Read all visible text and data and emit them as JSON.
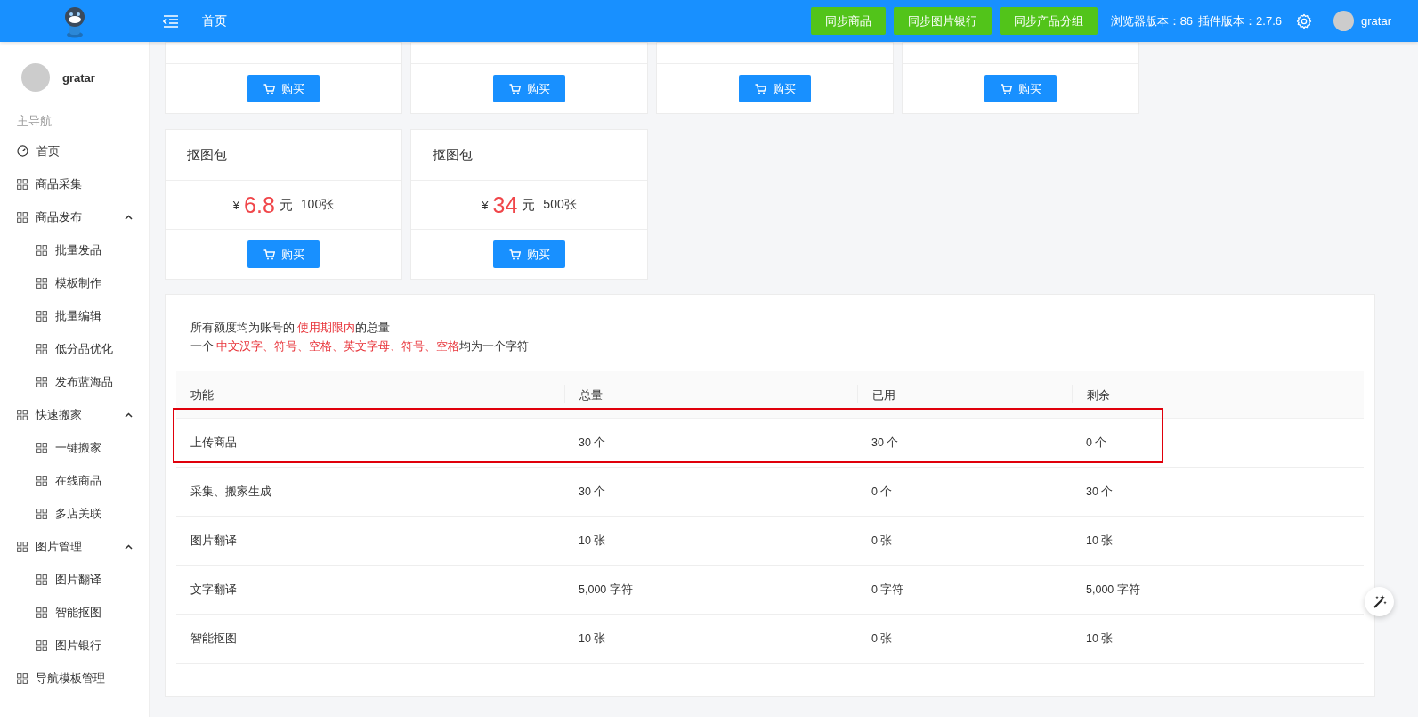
{
  "header": {
    "breadcrumb": "首页",
    "buttons": [
      "同步商品",
      "同步图片银行",
      "同步产品分组"
    ],
    "browser_version": "浏览器版本：86",
    "plugin_version": "插件版本：2.7.6",
    "user": "gratar"
  },
  "sidebar": {
    "user": "gratar",
    "section": "主导航",
    "items": [
      {
        "label": "首页",
        "kind": "dashboard"
      },
      {
        "label": "商品采集",
        "kind": "group"
      },
      {
        "label": "商品发布",
        "kind": "group",
        "expanded": true,
        "children": [
          {
            "label": "批量发品"
          },
          {
            "label": "模板制作"
          },
          {
            "label": "批量编辑"
          },
          {
            "label": "低分品优化"
          },
          {
            "label": "发布蓝海品"
          }
        ]
      },
      {
        "label": "快速搬家",
        "kind": "group",
        "expanded": true,
        "children": [
          {
            "label": "一键搬家"
          },
          {
            "label": "在线商品"
          },
          {
            "label": "多店关联"
          }
        ]
      },
      {
        "label": "图片管理",
        "kind": "group",
        "expanded": true,
        "children": [
          {
            "label": "图片翻译"
          },
          {
            "label": "智能抠图"
          },
          {
            "label": "图片银行"
          }
        ]
      },
      {
        "label": "导航模板管理",
        "kind": "group"
      }
    ]
  },
  "cut_cards": [
    {
      "button": "购买"
    },
    {
      "button": "购买"
    },
    {
      "button": "购买"
    },
    {
      "button": "购买"
    }
  ],
  "packages": [
    {
      "title": "抠图包",
      "currency": "¥",
      "price": "6.8",
      "unit": "元",
      "quantity": "100张",
      "button": "购买"
    },
    {
      "title": "抠图包",
      "currency": "¥",
      "price": "34",
      "unit": "元",
      "quantity": "500张",
      "button": "购买"
    }
  ],
  "notes": [
    [
      {
        "text": "所有额度均为账号的 ",
        "highlight": false
      },
      {
        "text": "使用期限内",
        "highlight": true
      },
      {
        "text": "的总量",
        "highlight": false
      }
    ],
    [
      {
        "text": "一个 ",
        "highlight": false
      },
      {
        "text": "中文汉字、符号、空格、英文字母、符号、空格",
        "highlight": true
      },
      {
        "text": "均为一个字符",
        "highlight": false
      }
    ]
  ],
  "table": {
    "columns": [
      "功能",
      "总量",
      "已用",
      "剩余"
    ],
    "rows": [
      {
        "cells": [
          "上传商品",
          "30 个",
          "30 个",
          "0 个"
        ],
        "highlighted": true
      },
      {
        "cells": [
          "采集、搬家生成",
          "30 个",
          "0 个",
          "30 个"
        ],
        "highlighted": false
      },
      {
        "cells": [
          "图片翻译",
          "10 张",
          "0 张",
          "10 张"
        ],
        "highlighted": false
      },
      {
        "cells": [
          "文字翻译",
          "5,000 字符",
          "0 字符",
          "5,000 字符"
        ],
        "highlighted": false
      },
      {
        "cells": [
          "智能抠图",
          "10 张",
          "0 张",
          "10 张"
        ],
        "highlighted": false
      }
    ]
  }
}
